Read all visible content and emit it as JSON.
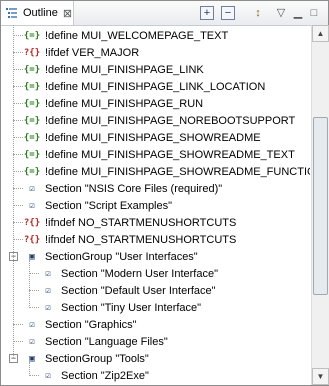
{
  "view": {
    "title": "Outline",
    "close_label": "⊠"
  },
  "toolbar": {
    "expand_all": "+",
    "collapse_all": "−",
    "sort_label": "↕",
    "menu_label": "▽",
    "min_label": "▁",
    "max_label": "□"
  },
  "colors": {
    "define": "#2b7a1f",
    "ifdef": "#b3261e",
    "section": "#1f3a6b"
  },
  "tree": {
    "items": [
      {
        "kind": "define",
        "text": "!define MUI_WELCOMEPAGE_TEXT"
      },
      {
        "kind": "ifdef",
        "text": "!ifdef VER_MAJOR"
      },
      {
        "kind": "define",
        "text": "!define MUI_FINISHPAGE_LINK"
      },
      {
        "kind": "define",
        "text": "!define MUI_FINISHPAGE_LINK_LOCATION"
      },
      {
        "kind": "define",
        "text": "!define MUI_FINISHPAGE_RUN"
      },
      {
        "kind": "define",
        "text": "!define MUI_FINISHPAGE_NOREBOOTSUPPORT"
      },
      {
        "kind": "define",
        "text": "!define MUI_FINISHPAGE_SHOWREADME"
      },
      {
        "kind": "define",
        "text": "!define MUI_FINISHPAGE_SHOWREADME_TEXT"
      },
      {
        "kind": "define",
        "text": "!define MUI_FINISHPAGE_SHOWREADME_FUNCTION"
      },
      {
        "kind": "section",
        "text": "Section \"NSIS Core Files (required)\""
      },
      {
        "kind": "section",
        "text": "Section \"Script Examples\""
      },
      {
        "kind": "ifdef",
        "text": "!ifndef NO_STARTMENUSHORTCUTS"
      },
      {
        "kind": "ifdef",
        "text": "!ifndef NO_STARTMENUSHORTCUTS"
      },
      {
        "kind": "group",
        "text": "SectionGroup \"User Interfaces\""
      },
      {
        "kind": "section",
        "text": "Section \"Modern User Interface\""
      },
      {
        "kind": "section",
        "text": "Section \"Default User Interface\""
      },
      {
        "kind": "section",
        "text": "Section \"Tiny User Interface\""
      },
      {
        "kind": "section",
        "text": "Section \"Graphics\""
      },
      {
        "kind": "section",
        "text": "Section \"Language Files\""
      },
      {
        "kind": "group",
        "text": "SectionGroup \"Tools\""
      },
      {
        "kind": "section",
        "text": "Section \"Zip2Exe\""
      }
    ]
  },
  "scrollbar": {
    "up": "▲",
    "down": "▼"
  }
}
